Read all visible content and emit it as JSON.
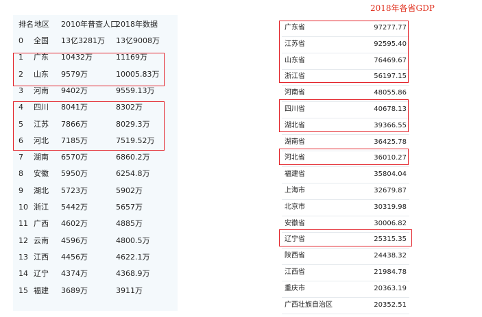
{
  "population_table": {
    "headers": {
      "rank": "排名",
      "region": "地区",
      "pop_2010": "2010年普查人口",
      "pop_2018": "2018年数据"
    },
    "rows": [
      {
        "rank": "0",
        "region": "全国",
        "pop_2010": "13亿3281万",
        "pop_2018": "13亿9008万"
      },
      {
        "rank": "1",
        "region": "广东",
        "pop_2010": "10432万",
        "pop_2018": "11169万"
      },
      {
        "rank": "2",
        "region": "山东",
        "pop_2010": "9579万",
        "pop_2018": "10005.83万"
      },
      {
        "rank": "3",
        "region": "河南",
        "pop_2010": "9402万",
        "pop_2018": "9559.13万"
      },
      {
        "rank": "4",
        "region": "四川",
        "pop_2010": "8041万",
        "pop_2018": "8302万"
      },
      {
        "rank": "5",
        "region": "江苏",
        "pop_2010": "7866万",
        "pop_2018": "8029.3万"
      },
      {
        "rank": "6",
        "region": "河北",
        "pop_2010": "7185万",
        "pop_2018": "7519.52万"
      },
      {
        "rank": "7",
        "region": "湖南",
        "pop_2010": "6570万",
        "pop_2018": "6860.2万"
      },
      {
        "rank": "8",
        "region": "安徽",
        "pop_2010": "5950万",
        "pop_2018": "6254.8万"
      },
      {
        "rank": "9",
        "region": "湖北",
        "pop_2010": "5723万",
        "pop_2018": "5902万"
      },
      {
        "rank": "10",
        "region": "浙江",
        "pop_2010": "5442万",
        "pop_2018": "5657万"
      },
      {
        "rank": "11",
        "region": "广西",
        "pop_2010": "4602万",
        "pop_2018": "4885万"
      },
      {
        "rank": "12",
        "region": "云南",
        "pop_2010": "4596万",
        "pop_2018": "4800.5万"
      },
      {
        "rank": "13",
        "region": "江西",
        "pop_2010": "4456万",
        "pop_2018": "4622.1万"
      },
      {
        "rank": "14",
        "region": "辽宁",
        "pop_2010": "4374万",
        "pop_2018": "4368.9万"
      },
      {
        "rank": "15",
        "region": "福建",
        "pop_2010": "3689万",
        "pop_2018": "3911万"
      }
    ]
  },
  "gdp_list": {
    "title": "2018年各省GDP",
    "rows": [
      {
        "province": "广东省",
        "gdp": "97277.77"
      },
      {
        "province": "江苏省",
        "gdp": "92595.40"
      },
      {
        "province": "山东省",
        "gdp": "76469.67"
      },
      {
        "province": "浙江省",
        "gdp": "56197.15"
      },
      {
        "province": "河南省",
        "gdp": "48055.86"
      },
      {
        "province": "四川省",
        "gdp": "40678.13"
      },
      {
        "province": "湖北省",
        "gdp": "39366.55"
      },
      {
        "province": "湖南省",
        "gdp": "36425.78"
      },
      {
        "province": "河北省",
        "gdp": "36010.27"
      },
      {
        "province": "福建省",
        "gdp": "35804.04"
      },
      {
        "province": "上海市",
        "gdp": "32679.87"
      },
      {
        "province": "北京市",
        "gdp": "30319.98"
      },
      {
        "province": "安徽省",
        "gdp": "30006.82"
      },
      {
        "province": "辽宁省",
        "gdp": "25315.35"
      },
      {
        "province": "陕西省",
        "gdp": "24438.32"
      },
      {
        "province": "江西省",
        "gdp": "21984.78"
      },
      {
        "province": "重庆市",
        "gdp": "20363.19"
      },
      {
        "province": "广西壮族自治区",
        "gdp": "20352.51"
      }
    ]
  },
  "colors": {
    "highlight": "#e3242b",
    "title": "#e0301e",
    "table_bg": "#f4f9fc"
  }
}
